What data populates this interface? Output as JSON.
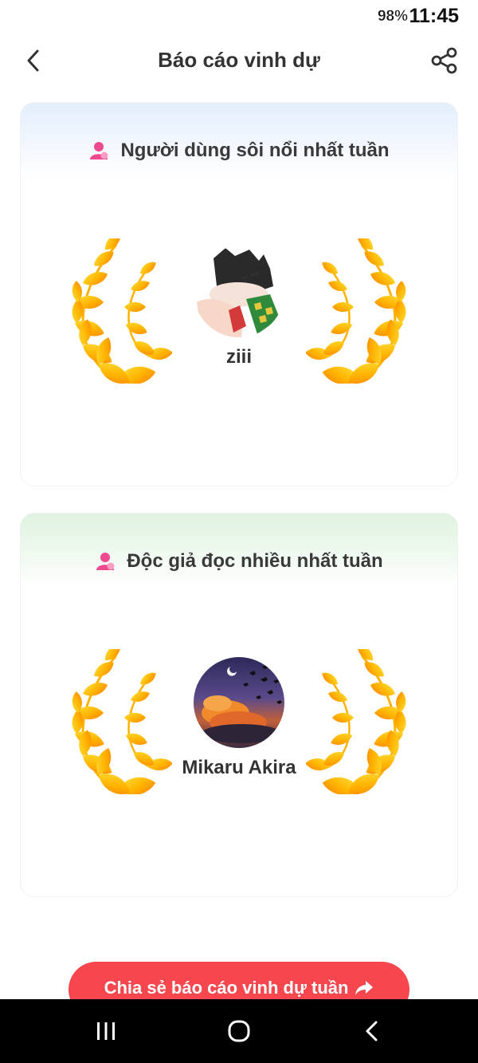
{
  "status_bar": {
    "battery": "98%",
    "time": "11:45"
  },
  "header": {
    "title": "Báo cáo vinh dự",
    "back_icon": "chevron-left-icon",
    "share_icon": "share-icon"
  },
  "cards": [
    {
      "title": "Người dùng sôi nổi nhất tuần",
      "icon": "user-icon",
      "user_name": "ziii",
      "accent": "#e3eefc"
    },
    {
      "title": "Độc giả đọc nhiều nhất tuần",
      "icon": "user-icon",
      "user_name": "Mikaru Akira",
      "accent": "#def3df"
    }
  ],
  "cta": {
    "label": "Chia sẻ báo cáo vinh dự tuần",
    "icon": "share-arrow-icon",
    "color": "#f5474d"
  },
  "colors": {
    "laurel_light": "#ffd21f",
    "laurel_dark": "#ff8a00",
    "user_icon": "#ee4a8f"
  }
}
